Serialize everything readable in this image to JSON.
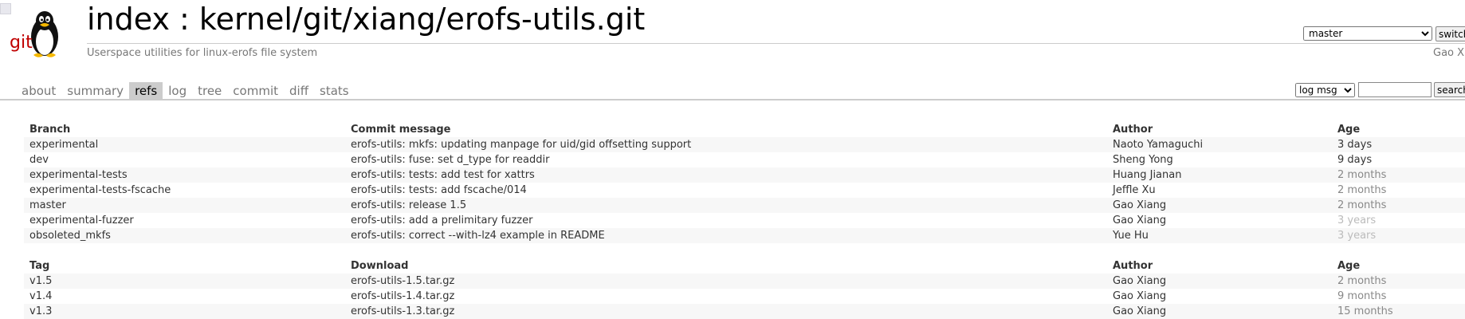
{
  "header": {
    "logo_text": "git",
    "title": "index : kernel/git/xiang/erofs-utils.git",
    "description": "Userspace utilities for linux-erofs file system",
    "owner": "Gao Xi",
    "branch_selected": "master",
    "switch_label": "switch"
  },
  "tabs": [
    "about",
    "summary",
    "refs",
    "log",
    "tree",
    "commit",
    "diff",
    "stats"
  ],
  "active_tab": "refs",
  "search": {
    "type_selected": "log msg",
    "value": "",
    "button_label": "search"
  },
  "branches": {
    "headers": [
      "Branch",
      "Commit message",
      "Author",
      "Age"
    ],
    "rows": [
      {
        "name": "experimental",
        "message": "erofs-utils: mkfs: updating manpage for uid/gid offsetting support",
        "author": "Naoto Yamaguchi",
        "age": "3 days",
        "age_class": "recent"
      },
      {
        "name": "dev",
        "message": "erofs-utils: fuse: set d_type for readdir",
        "author": "Sheng Yong",
        "age": "9 days",
        "age_class": "recent"
      },
      {
        "name": "experimental-tests",
        "message": "erofs-utils: tests: add test for xattrs",
        "author": "Huang Jianan",
        "age": "2 months",
        "age_class": "months"
      },
      {
        "name": "experimental-tests-fscache",
        "message": "erofs-utils: tests: add fscache/014",
        "author": "Jeffle Xu",
        "age": "2 months",
        "age_class": "months"
      },
      {
        "name": "master",
        "message": "erofs-utils: release 1.5",
        "author": "Gao Xiang",
        "age": "2 months",
        "age_class": "months"
      },
      {
        "name": "experimental-fuzzer",
        "message": "erofs-utils: add a prelimitary fuzzer",
        "author": "Gao Xiang",
        "age": "3 years",
        "age_class": "years"
      },
      {
        "name": "obsoleted_mkfs",
        "message": "erofs-utils: correct --with-lz4 example in README",
        "author": "Yue Hu",
        "age": "3 years",
        "age_class": "years"
      }
    ]
  },
  "tags": {
    "headers": [
      "Tag",
      "Download",
      "Author",
      "Age"
    ],
    "rows": [
      {
        "name": "v1.5",
        "download": "erofs-utils-1.5.tar.gz",
        "author": "Gao Xiang",
        "age": "2 months",
        "age_class": "months"
      },
      {
        "name": "v1.4",
        "download": "erofs-utils-1.4.tar.gz",
        "author": "Gao Xiang",
        "age": "9 months",
        "age_class": "months"
      },
      {
        "name": "v1.3",
        "download": "erofs-utils-1.3.tar.gz",
        "author": "Gao Xiang",
        "age": "15 months",
        "age_class": "months"
      }
    ]
  }
}
